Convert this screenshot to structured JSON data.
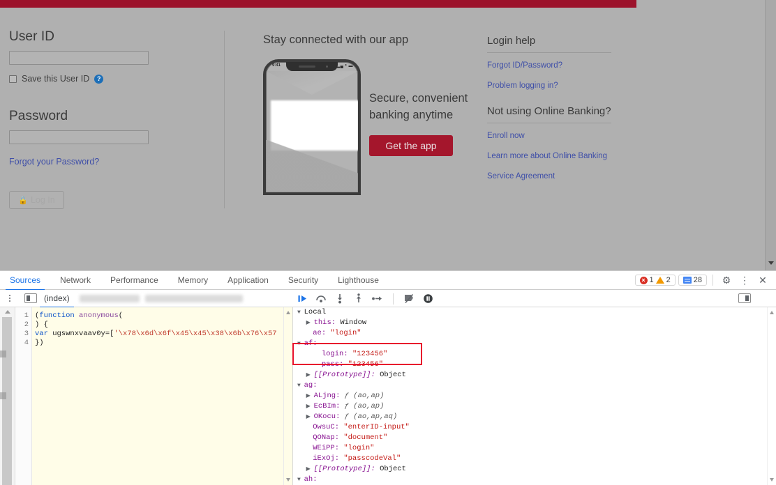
{
  "page": {
    "brand_color": "#9c122b",
    "login": {
      "userid_label": "User ID",
      "userid_value": "",
      "userid_placeholder": "",
      "save_userid_label": "Save this User ID",
      "help_icon_glyph": "?",
      "password_label": "Password",
      "password_value": "",
      "password_placeholder": "",
      "forgot_password_link": "Forgot your Password?",
      "login_button_label": "Log In",
      "lock_icon_glyph": "\u0001"
    },
    "app_promo": {
      "heading": "Stay connected with our app",
      "copy_line_1": "Secure, convenient",
      "copy_line_2": "banking anytime",
      "cta_label": "Get the app",
      "cta_color": "#a4162c",
      "phone_time": "9:41",
      "phone_status": "▂▄ ᵜ ▬"
    },
    "help": {
      "heading_1": "Login help",
      "links_1": [
        "Forgot ID/Password?",
        "Problem logging in?"
      ],
      "heading_2": "Not using Online Banking?",
      "links_2": [
        "Enroll now",
        "Learn more about Online Banking",
        "Service Agreement"
      ],
      "link_color": "#3f4fa8"
    }
  },
  "devtools": {
    "tabs": [
      {
        "label": "Sources",
        "active": true
      },
      {
        "label": "Network",
        "active": false
      },
      {
        "label": "Performance",
        "active": false
      },
      {
        "label": "Memory",
        "active": false
      },
      {
        "label": "Application",
        "active": false
      },
      {
        "label": "Security",
        "active": false
      },
      {
        "label": "Lighthouse",
        "active": false
      }
    ],
    "status": {
      "error_count": "1",
      "warning_count": "2",
      "message_count": "28",
      "error_color": "#d93025",
      "warning_color": "#f29900",
      "message_color": "#4285f4"
    },
    "toolbar_icons": {
      "settings": "⚙",
      "more": "⋮",
      "close": "✕"
    },
    "sources": {
      "file_tab": "(index)",
      "redacted_tab_1": "",
      "redacted_tab_2": "",
      "debugger_controls": [
        "resume-script-execution",
        "step-over-next-function-call",
        "step-into-next-function-call",
        "step-out-of-current-function",
        "step",
        "deactivate-breakpoints",
        "pause-on-exceptions"
      ],
      "code_lines": [
        {
          "n": "1",
          "tokens": [
            {
              "t": "(",
              "c": "plain"
            },
            {
              "t": "function",
              "c": "kw"
            },
            {
              "t": " ",
              "c": "plain"
            },
            {
              "t": "anonymous",
              "c": "fn"
            },
            {
              "t": "(",
              "c": "plain"
            }
          ]
        },
        {
          "n": "2",
          "tokens": [
            {
              "t": ") {",
              "c": "plain"
            }
          ]
        },
        {
          "n": "3",
          "tokens": [
            {
              "t": "var",
              "c": "kw"
            },
            {
              "t": " ugswnxvaav0y=[",
              "c": "plain"
            },
            {
              "t": "'\\x78\\x6d\\x6f\\x45\\x45\\x38\\x6b\\x76\\x57",
              "c": "str"
            }
          ]
        },
        {
          "n": "4",
          "tokens": [
            {
              "t": "})",
              "c": "plain"
            }
          ]
        }
      ]
    },
    "scope": {
      "lines": [
        {
          "indent": 0,
          "tri": "▼",
          "name": "Local",
          "name_class": "sval-obj",
          "sep": "",
          "value": "",
          "value_class": ""
        },
        {
          "indent": 1,
          "tri": "▶",
          "name": "this",
          "name_class": "prop",
          "sep": ": ",
          "value": "Window",
          "value_class": "sval-obj"
        },
        {
          "indent": 1,
          "tri": "",
          "name": "ae",
          "name_class": "prop",
          "sep": ": ",
          "value": "\"login\"",
          "value_class": "sval-str"
        },
        {
          "indent": 0,
          "tri": "▼",
          "name": "af",
          "name_class": "prop",
          "sep": ":",
          "value": "",
          "value_class": ""
        },
        {
          "indent": 2,
          "tri": "",
          "name": "login",
          "name_class": "prop",
          "sep": ": ",
          "value": "\"123456\"",
          "value_class": "sval-str"
        },
        {
          "indent": 2,
          "tri": "",
          "name": "pass",
          "name_class": "prop",
          "sep": ": ",
          "value": "\"123456\"",
          "value_class": "sval-str"
        },
        {
          "indent": 1,
          "tri": "▶",
          "name": "[[Prototype]]",
          "name_class": "ital",
          "sep": ": ",
          "value": "Object",
          "value_class": "sval-obj"
        },
        {
          "indent": 0,
          "tri": "▼",
          "name": "ag",
          "name_class": "prop",
          "sep": ":",
          "value": "",
          "value_class": ""
        },
        {
          "indent": 1,
          "tri": "▶",
          "name": "ALjng",
          "name_class": "prop",
          "sep": ": ",
          "value": "ƒ (ao,ap)",
          "value_class": "ital-g"
        },
        {
          "indent": 1,
          "tri": "▶",
          "name": "EcBIm",
          "name_class": "prop",
          "sep": ": ",
          "value": "ƒ (ao,ap)",
          "value_class": "ital-g"
        },
        {
          "indent": 1,
          "tri": "▶",
          "name": "OKocu",
          "name_class": "prop",
          "sep": ": ",
          "value": "ƒ (ao,ap,aq)",
          "value_class": "ital-g"
        },
        {
          "indent": 1,
          "tri": "",
          "name": "OwsuC",
          "name_class": "prop",
          "sep": ": ",
          "value": "\"enterID-input\"",
          "value_class": "sval-str"
        },
        {
          "indent": 1,
          "tri": "",
          "name": "QONap",
          "name_class": "prop",
          "sep": ": ",
          "value": "\"document\"",
          "value_class": "sval-str"
        },
        {
          "indent": 1,
          "tri": "",
          "name": "WEiPP",
          "name_class": "prop",
          "sep": ": ",
          "value": "\"login\"",
          "value_class": "sval-str"
        },
        {
          "indent": 1,
          "tri": "",
          "name": "iExOj",
          "name_class": "prop",
          "sep": ": ",
          "value": "\"passcodeVal\"",
          "value_class": "sval-str"
        },
        {
          "indent": 1,
          "tri": "▶",
          "name": "[[Prototype]]",
          "name_class": "ital",
          "sep": ": ",
          "value": "Object",
          "value_class": "sval-obj"
        },
        {
          "indent": 0,
          "tri": "▼",
          "name": "ah",
          "name_class": "prop",
          "sep": ":",
          "value": "",
          "value_class": ""
        }
      ],
      "highlight_color": "#e8112d"
    }
  }
}
